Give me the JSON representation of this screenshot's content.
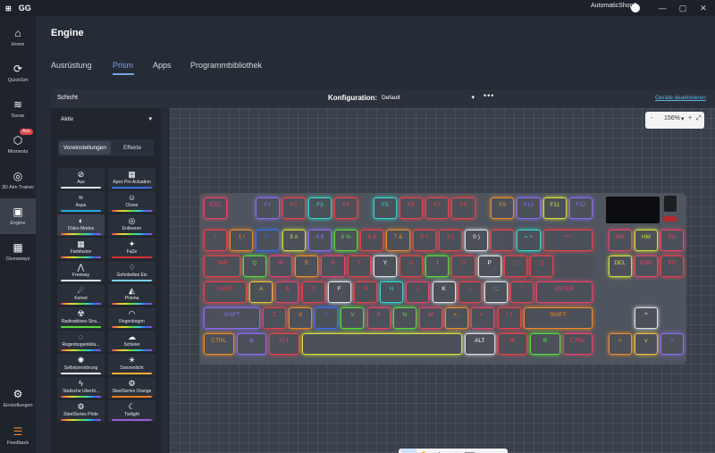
{
  "titlebar": {
    "logo": "⊞",
    "app": "GG",
    "user": "AutomaticShop3",
    "minimize": "—",
    "maximize": "▢",
    "close": "✕"
  },
  "sidebar": {
    "items": [
      {
        "icon": "⌂",
        "label": "Home"
      },
      {
        "icon": "⟳",
        "label": "QuickSet"
      },
      {
        "icon": "≋",
        "label": "Sonar"
      },
      {
        "icon": "⬡",
        "label": "Moments",
        "badge": "Aus"
      },
      {
        "icon": "◎",
        "label": "3D Aim Trainer"
      },
      {
        "icon": "▣",
        "label": "Engine"
      },
      {
        "icon": "▦",
        "label": "Giveaways"
      },
      {
        "icon": "⚙",
        "label": "Einstellungen"
      },
      {
        "icon": "☰",
        "label": "Feedback"
      }
    ]
  },
  "main": {
    "title": "Engine",
    "tabs": [
      "Ausrüstung",
      "Prism",
      "Apps",
      "Programmbibliothek"
    ],
    "active_tab": "Prism"
  },
  "panelbar": {
    "schicht": "Schicht",
    "konfig_label": "Konfiguration:",
    "konfig_value": "Default",
    "more": "•••",
    "geraete": "Geräte deaktivieren"
  },
  "left": {
    "layer_value": "Aktiv",
    "subtabs": [
      "Voreinstellungen",
      "Effekte"
    ],
    "effects": [
      {
        "icon": "⊘",
        "label": "Aus",
        "bar": "#dfe2e6"
      },
      {
        "icon": "▦",
        "label": "Apex Pro Actuation",
        "bar": "#3b6ee0"
      },
      {
        "icon": "≈",
        "label": "Aqua",
        "bar": "#2aa8e0"
      },
      {
        "icon": "☺",
        "label": "Clown",
        "bar": "rainbow"
      },
      {
        "icon": "◐",
        "label": "Disko-Modus",
        "bar": "rainbow"
      },
      {
        "icon": "◎",
        "label": "Entleeren",
        "bar": "rainbow"
      },
      {
        "icon": "▦",
        "label": "Farbfusion",
        "bar": "rainbow"
      },
      {
        "icon": "✦",
        "label": "FaZe",
        "bar": "#d42f2f"
      },
      {
        "icon": "⋀",
        "label": "Freeway",
        "bar": "#dfe2e6"
      },
      {
        "icon": "♢",
        "label": "Gehobeltes Eis",
        "bar": "#7ad0f0"
      },
      {
        "icon": "☄",
        "label": "Komet",
        "bar": "rainbow"
      },
      {
        "icon": "◭",
        "label": "Prisma",
        "bar": "rainbow"
      },
      {
        "icon": "☢",
        "label": "Radioaktives Stra...",
        "bar": "#5adb3c"
      },
      {
        "icon": "◠",
        "label": "Regenbogen",
        "bar": "rainbow"
      },
      {
        "icon": "◌",
        "label": "Regenbogenteilu...",
        "bar": "rainbow"
      },
      {
        "icon": "☁",
        "label": "Schleier",
        "bar": "rainbow"
      },
      {
        "icon": "✺",
        "label": "Selbstzerstörung",
        "bar": "#dfe2e6"
      },
      {
        "icon": "☀",
        "label": "Sonnenlicht",
        "bar": "#f0b030"
      },
      {
        "icon": "ϟ",
        "label": "Statische Überbl...",
        "bar": "rainbow"
      },
      {
        "icon": "⚙",
        "label": "SteelSeries Orange",
        "bar": "#f07a1a"
      },
      {
        "icon": "⚙",
        "label": "SteelSeries Pride",
        "bar": "rainbow"
      },
      {
        "icon": "☾",
        "label": "Twilight",
        "bar": "#9a5ad8"
      }
    ]
  },
  "zoom": {
    "minus": "-",
    "value": "156%",
    "plus": "+",
    "fit": "⤢"
  },
  "keyboard": {
    "keys": [
      {
        "l": "ESC",
        "c": "#e8436c"
      },
      {
        "l": "F1",
        "c": "#8b6cf0"
      },
      {
        "l": "F2",
        "c": "#e8414a"
      },
      {
        "l": "F3",
        "c": "#35d6d0"
      },
      {
        "l": "F4",
        "c": "#e8414a"
      },
      {
        "l": "F5",
        "c": "#35d6d0"
      },
      {
        "l": "F6",
        "c": "#e8414a"
      },
      {
        "l": "F7",
        "c": "#e8414a"
      },
      {
        "l": "F8",
        "c": "#e8414a"
      },
      {
        "l": "F9",
        "c": "#f08a2a"
      },
      {
        "l": "F10",
        "c": "#8b6cf0"
      },
      {
        "l": "F11",
        "c": "#d6e03a"
      },
      {
        "l": "F12",
        "c": "#8b6cf0"
      },
      {
        "l": "^",
        "c": "#e8414a"
      },
      {
        "l": "1 !",
        "c": "#f08a2a"
      },
      {
        "l": "2 \"",
        "c": "#3a6cf0"
      },
      {
        "l": "3 #",
        "c": "#d6e03a"
      },
      {
        "l": "4 $",
        "c": "#8b6cf0"
      },
      {
        "l": "5 %",
        "c": "#5adb3c"
      },
      {
        "l": "6 &",
        "c": "#e8414a"
      },
      {
        "l": "7 &",
        "c": "#f08a2a"
      },
      {
        "l": "8 +",
        "c": "#e8414a"
      },
      {
        "l": "9 (",
        "c": "#e8414a"
      },
      {
        "l": "0 )",
        "c": "#dfe2e6"
      },
      {
        "l": "_ -",
        "c": "#e8414a"
      },
      {
        "l": "= +",
        "c": "#35d6d0"
      },
      {
        "l": "⟵",
        "c": "#e8414a"
      },
      {
        "l": "INS",
        "c": "#e8436c"
      },
      {
        "l": "HM",
        "c": "#d6e03a"
      },
      {
        "l": "PU",
        "c": "#e8436c"
      },
      {
        "l": "TAB",
        "c": "#e8414a"
      },
      {
        "l": "Q",
        "c": "#5adb3c"
      },
      {
        "l": "W",
        "c": "#e8436c"
      },
      {
        "l": "E",
        "c": "#f08a2a"
      },
      {
        "l": "R",
        "c": "#e8436c"
      },
      {
        "l": "T",
        "c": "#e8414a"
      },
      {
        "l": "Y",
        "c": "#dfe2e6"
      },
      {
        "l": "U",
        "c": "#e8414a"
      },
      {
        "l": "I",
        "c": "#5adb3c"
      },
      {
        "l": "O",
        "c": "#e8414a"
      },
      {
        "l": "P",
        "c": "#dfe2e6"
      },
      {
        "l": "[ {",
        "c": "#e8414a"
      },
      {
        "l": "] }",
        "c": "#e8414a"
      },
      {
        "l": "\\ |",
        "c": "#4b5059"
      },
      {
        "l": "DEL",
        "c": "#d6e03a"
      },
      {
        "l": "END",
        "c": "#e8436c"
      },
      {
        "l": "PD",
        "c": "#e8414a"
      },
      {
        "l": "CAPS",
        "c": "#e8414a"
      },
      {
        "l": "A",
        "c": "#f0c03a"
      },
      {
        "l": "S",
        "c": "#e8436c"
      },
      {
        "l": "D",
        "c": "#e8414a"
      },
      {
        "l": "F",
        "c": "#dfe2e6"
      },
      {
        "l": "G",
        "c": "#e8414a"
      },
      {
        "l": "H",
        "c": "#35d6d0"
      },
      {
        "l": "J",
        "c": "#e8436c"
      },
      {
        "l": "K",
        "c": "#dfe2e6"
      },
      {
        "l": "L",
        "c": "#e8414a"
      },
      {
        "l": ": ;",
        "c": "#dfe2e6"
      },
      {
        "l": "\" '",
        "c": "#e8414a"
      },
      {
        "l": "ENTER",
        "c": "#e8436c"
      },
      {
        "l": "SHIFT",
        "c": "#8b6cf0"
      },
      {
        "l": "Z",
        "c": "#e8414a"
      },
      {
        "l": "X",
        "c": "#f08a2a"
      },
      {
        "l": "C",
        "c": "#3a6cf0"
      },
      {
        "l": "V",
        "c": "#5adb3c"
      },
      {
        "l": "B",
        "c": "#e8436c"
      },
      {
        "l": "N",
        "c": "#5adb3c"
      },
      {
        "l": "M",
        "c": "#e8436c"
      },
      {
        "l": "< ,",
        "c": "#f08a2a"
      },
      {
        "l": "> .",
        "c": "#e8436c"
      },
      {
        "l": "/ ?",
        "c": "#e8414a"
      },
      {
        "l": "SHIFT",
        "c": "#f08a2a"
      },
      {
        "l": "^",
        "c": "#dfe2e6"
      },
      {
        "l": "CTRL",
        "c": "#f08a2a"
      },
      {
        "l": "⊞",
        "c": "#8b6cf0"
      },
      {
        "l": "ALT",
        "c": "#e8414a"
      },
      {
        "l": "",
        "c": "#d6e03a"
      },
      {
        "l": "ALT",
        "c": "#dfe2e6"
      },
      {
        "l": "⊞",
        "c": "#e8414a"
      },
      {
        "l": "⚙",
        "c": "#5adb3c"
      },
      {
        "l": "CTRL",
        "c": "#e8436c"
      },
      {
        "l": "<",
        "c": "#f08a2a"
      },
      {
        "l": "v",
        "c": "#f0c03a"
      },
      {
        "l": ">",
        "c": "#8b6cf0"
      }
    ]
  },
  "toolbar": [
    {
      "icon": "↖",
      "name": "select-tool-icon"
    },
    {
      "icon": "✋",
      "name": "hand-tool-icon"
    },
    {
      "icon": "✥",
      "name": "move-tool-icon"
    },
    {
      "icon": "↺",
      "name": "reset-tool-icon"
    },
    {
      "icon": "⌨",
      "name": "keyboard-tool-icon"
    }
  ]
}
